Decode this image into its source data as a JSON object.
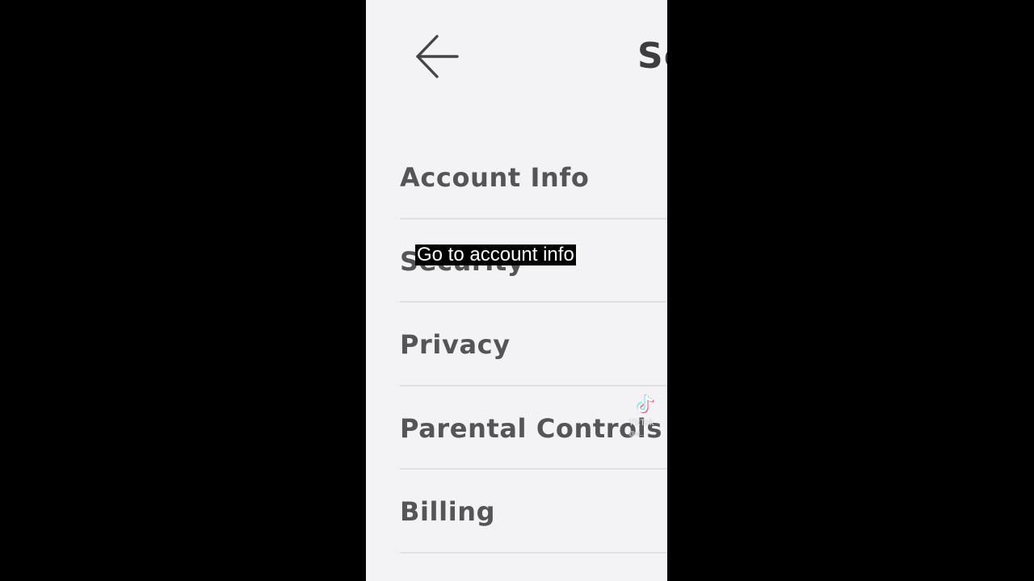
{
  "header": {
    "title": "Se",
    "back_icon": "arrow-left-icon"
  },
  "settings": {
    "items": [
      {
        "label": "Account Info"
      },
      {
        "label": "Security"
      },
      {
        "label": "Privacy"
      },
      {
        "label": "Parental Controls"
      },
      {
        "label": "Billing"
      }
    ]
  },
  "caption": {
    "text": "Go to account info"
  },
  "watermark": {
    "brand": "TikTok",
    "handle": "@w..."
  },
  "colors": {
    "page_background": "#000000",
    "screen_background": "#f3f3f5",
    "item_text": "#555558",
    "divider": "#e0e0e3",
    "caption_background": "#000000",
    "caption_text": "#ffffff"
  }
}
